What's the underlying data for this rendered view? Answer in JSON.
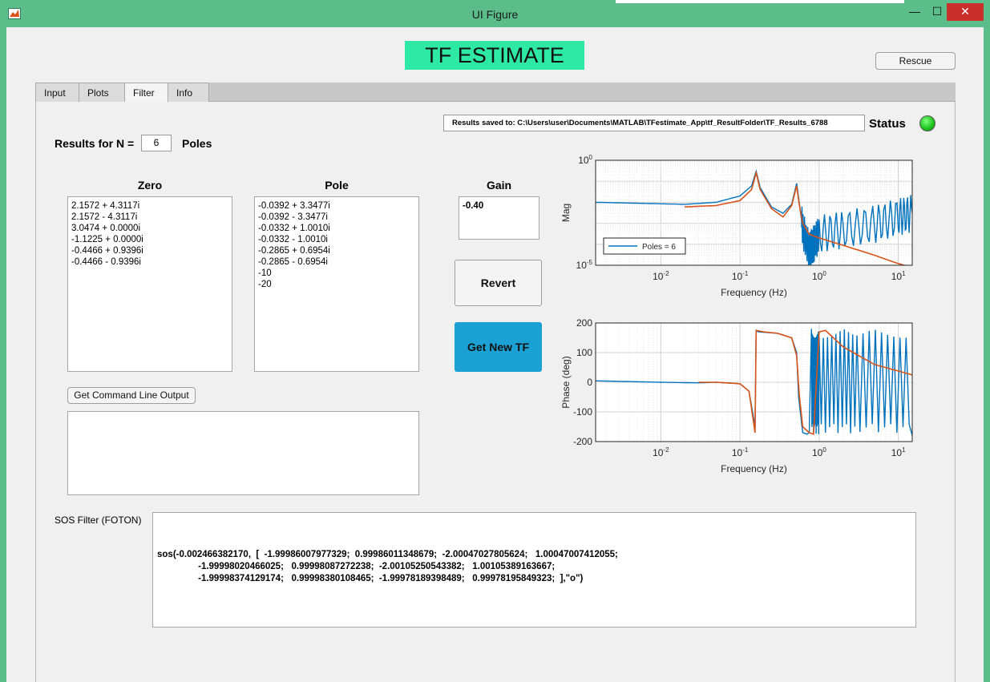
{
  "window": {
    "title": "UI Figure",
    "minimize": "—",
    "maximize": "☐",
    "close": "✕"
  },
  "header": {
    "banner": "TF ESTIMATE",
    "rescue_label": "Rescue"
  },
  "tabs": [
    {
      "label": "Input"
    },
    {
      "label": "Plots"
    },
    {
      "label": "Filter"
    },
    {
      "label": "Info"
    }
  ],
  "active_tab": "Filter",
  "status": {
    "results_path": "Results saved to: C:\\Users\\user\\Documents\\MATLAB\\TFestimate_App\\tf_ResultFolder\\TF_Results_6788",
    "label": "Status",
    "led_color": "#1ac01a"
  },
  "results": {
    "label": "Results for N =",
    "n_value": "6",
    "suffix": "Poles"
  },
  "zero": {
    "header": "Zero",
    "items": [
      "2.1572 + 4.3117i",
      "2.1572 - 4.3117i",
      "3.0474 + 0.0000i",
      "-1.1225 + 0.0000i",
      "-0.4466 + 0.9396i",
      "-0.4466 - 0.9396i"
    ]
  },
  "pole": {
    "header": "Pole",
    "items": [
      "-0.0392 + 3.3477i",
      "-0.0392 - 3.3477i",
      "-0.0332 + 1.0010i",
      "-0.0332 - 1.0010i",
      "-0.2865 + 0.6954i",
      "-0.2865 - 0.6954i",
      "-10",
      "-20"
    ]
  },
  "gain": {
    "header": "Gain",
    "value": "-0.40"
  },
  "buttons": {
    "revert": "Revert",
    "get_new_tf": "Get New TF",
    "command_line": "Get Command Line Output"
  },
  "sos": {
    "label": "SOS Filter (FOTON)",
    "line1": "sos(-0.002466382170,  [  -1.99986007977329;  0.99986011348679;  -2.00047027805624;   1.00047007412055;",
    "line2": "                -1.99998020466025;   0.99998087272238;  -2.00105250543382;   1.00105389163667;",
    "line3": "                -1.99998374129174;   0.99998380108465;  -1.99978189398489;   0.99978195849323;  ],\"o\")"
  },
  "chart_data": [
    {
      "type": "line",
      "xlabel": "Frequency (Hz)",
      "ylabel": "Mag",
      "xscale": "log",
      "yscale": "log",
      "xlim": [
        0.0015,
        15
      ],
      "ylim": [
        1e-05,
        1
      ],
      "xticks": [
        "10^-2",
        "10^-1",
        "10^0",
        "10^1"
      ],
      "yticks": [
        "10^0",
        "10^-5"
      ],
      "grid": true,
      "legend": "bottom-left",
      "series": [
        {
          "name": "Poles = 6",
          "color": "#0072bd",
          "x": [
            0.0015,
            0.005,
            0.02,
            0.05,
            0.1,
            0.14,
            0.16,
            0.18,
            0.25,
            0.35,
            0.45,
            0.52,
            0.56,
            0.62,
            0.75,
            0.85,
            1,
            2,
            5,
            10,
            15
          ],
          "y": [
            0.01,
            0.009,
            0.008,
            0.01,
            0.02,
            0.06,
            0.3,
            0.05,
            0.006,
            0.003,
            0.008,
            0.08,
            0.01,
            0.0005,
            5e-05,
            0.0001,
            0.0003,
            0.0005,
            0.0009,
            0.002,
            0.003
          ]
        },
        {
          "name": "",
          "color": "#d95319",
          "x": [
            0.02,
            0.05,
            0.1,
            0.14,
            0.16,
            0.18,
            0.25,
            0.35,
            0.45,
            0.52,
            0.56,
            0.62,
            0.75,
            1,
            2,
            5,
            10,
            15
          ],
          "y": [
            0.006,
            0.007,
            0.012,
            0.04,
            0.25,
            0.04,
            0.005,
            0.002,
            0.007,
            0.06,
            0.008,
            0.001,
            0.0003,
            0.0002,
            9e-05,
            3e-05,
            1.2e-05,
            8e-06
          ]
        }
      ]
    },
    {
      "type": "line",
      "xlabel": "Frequency (Hz)",
      "ylabel": "Phase (deg)",
      "xscale": "log",
      "xlim": [
        0.0015,
        15
      ],
      "ylim": [
        -200,
        200
      ],
      "xticks": [
        "10^-2",
        "10^-1",
        "10^0",
        "10^1"
      ],
      "yticks": [
        "200",
        "100",
        "0",
        "-100",
        "-200"
      ],
      "grid": true,
      "series": [
        {
          "name": "",
          "color": "#0072bd",
          "x": [
            0.0015,
            0.01,
            0.03,
            0.05,
            0.1,
            0.13,
            0.155,
            0.16,
            0.17,
            0.3,
            0.45,
            0.52,
            0.55,
            0.62,
            0.7,
            0.75,
            0.8,
            1,
            3,
            15
          ],
          "y": [
            5,
            0,
            -2,
            0,
            -5,
            -30,
            -150,
            175,
            170,
            165,
            150,
            100,
            -50,
            -170,
            -175,
            -170,
            180,
            -180,
            180,
            -180
          ]
        },
        {
          "name": "",
          "color": "#d95319",
          "x": [
            0.03,
            0.05,
            0.1,
            0.13,
            0.155,
            0.16,
            0.2,
            0.3,
            0.45,
            0.52,
            0.56,
            0.62,
            0.75,
            0.85,
            1,
            1.2,
            2,
            5,
            15
          ],
          "y": [
            0,
            0,
            -5,
            -30,
            -170,
            175,
            170,
            165,
            150,
            90,
            -40,
            -150,
            -170,
            -175,
            170,
            175,
            120,
            60,
            25
          ]
        }
      ]
    }
  ]
}
